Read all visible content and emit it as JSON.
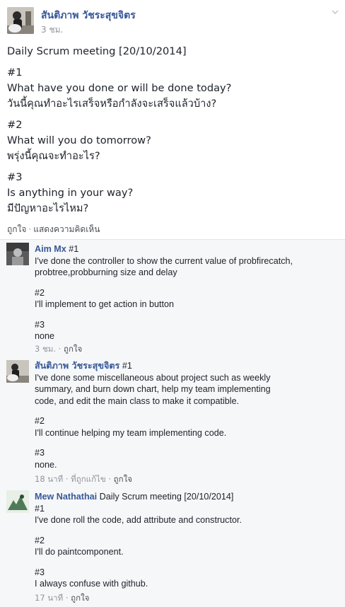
{
  "post": {
    "author": "สันติภาพ วัชระสุขจิตร",
    "time": "3 ชม.",
    "lines": [
      "Daily Scrum meeting [20/10/2014]",
      "",
      "#1",
      "What have you done or will be done today?",
      "วันนี้คุณทำอะไรเสร็จหรือกำลังจะเสร็จแล้วบ้าง?",
      "",
      "#2",
      "What will you do tomorrow?",
      "พรุ่งนี้คุณจะทำอะไร?",
      "",
      "#3",
      "Is anything in your way?",
      "มีปัญหาอะไรไหม?"
    ],
    "actions": {
      "like": "ถูกใจ",
      "separator": "·",
      "comment": "แสดงความคิดเห็น"
    }
  },
  "comments": [
    {
      "author": "Aim Mx",
      "first_line": "#1",
      "lines": [
        "I've done the controller to show the current value of probfirecatch,",
        "probtree,probburning size and delay",
        "",
        "#2",
        "I'll implement to get action in button",
        "",
        "#3",
        "none"
      ],
      "time": "3 ชม.",
      "meta_sep": "·",
      "like": "ถูกใจ"
    },
    {
      "author": "สันติภาพ วัชระสุขจิตร",
      "first_line": "#1",
      "lines": [
        "I've done some miscellaneous about project such as weekly",
        "summary, and burn down chart, help my team implementing",
        "code, and edit the main class to make it compatible.",
        "",
        "#2",
        "I'll continue helping my team implementing code.",
        "",
        "#3",
        "none."
      ],
      "time": "18 นาที",
      "meta_sep": "·",
      "edited": "ที่ถูกแก้ไข",
      "like": "ถูกใจ"
    },
    {
      "author": "Mew Nathathai",
      "first_line": "Daily Scrum meeting [20/10/2014]",
      "lines": [
        "#1",
        "I've done roll the code, add attribute and constructor.",
        "",
        "#2",
        "I'll do paintcomponent.",
        "",
        "#3",
        "I always confuse with github."
      ],
      "time": "17 นาที",
      "meta_sep": "·",
      "like": "ถูกใจ"
    }
  ],
  "icons": {
    "post_menu": "chevron-down-icon"
  },
  "colors": {
    "link_blue": "#365899",
    "meta_gray": "#90949c",
    "comments_bg": "#f6f7f9"
  }
}
